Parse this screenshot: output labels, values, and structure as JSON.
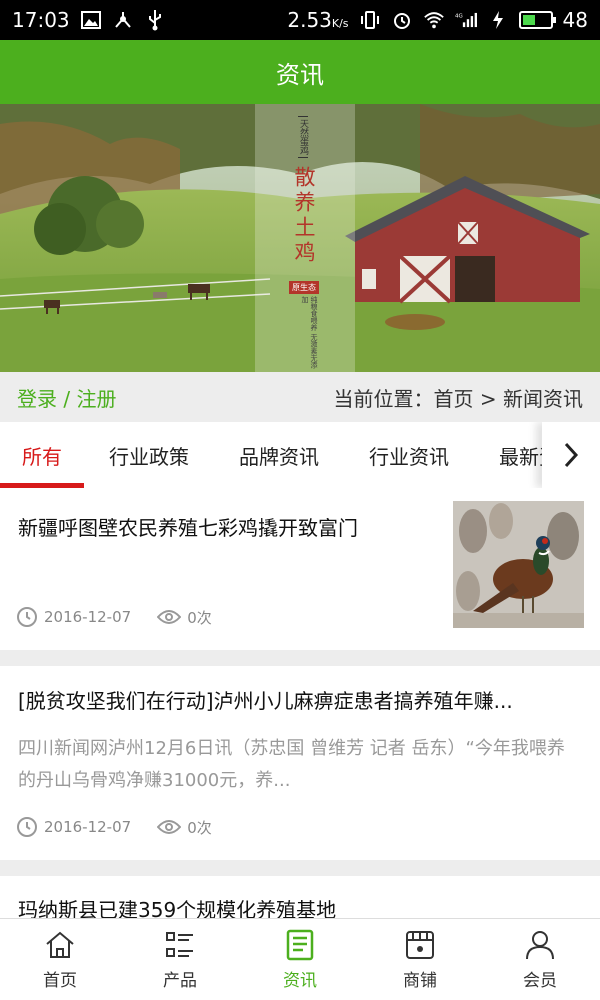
{
  "status_bar": {
    "time": "17:03",
    "speed": "2.53",
    "speed_unit": "K/s",
    "network": "4G",
    "battery": "48",
    "battery_fraction": 0.48,
    "icons": [
      "image-icon",
      "usb-hub-icon",
      "usb-icon",
      "vibrate-icon",
      "alarm-icon",
      "wifi-icon",
      "signal-icon",
      "charging-icon",
      "battery-icon"
    ]
  },
  "header": {
    "title": "资讯"
  },
  "banner": {
    "poster_tag": "天然蛋鸡",
    "poster_title": "散养土鸡",
    "poster_badge": "原生态",
    "poster_small": "纯粮食喂养 无激素无添加"
  },
  "location_bar": {
    "login_label": "登录 / 注册",
    "location_text": "当前位置：首页 > 新闻资讯"
  },
  "tabs": {
    "items": [
      "所有",
      "行业政策",
      "品牌资讯",
      "行业资讯",
      "最新资讯"
    ],
    "active_index": 0
  },
  "articles": [
    {
      "title": "新疆呼图壁农民养殖七彩鸡撬开致富门",
      "date": "2016-12-07",
      "views": "0次",
      "has_thumbnail": true
    },
    {
      "title": "[脱贫攻坚我们在行动]泸州小儿麻痹症患者搞养殖年赚...",
      "summary": "四川新闻网泸州12月6日讯（苏忠国 曾维芳 记者 岳东）“今年我喂养的丹山乌骨鸡净赚31000元，养...",
      "date": "2016-12-07",
      "views": "0次"
    },
    {
      "title": "玛纳斯县已建359个规模化养殖基地"
    }
  ],
  "bottom_nav": {
    "items": [
      {
        "label": "首页",
        "icon": "home-icon"
      },
      {
        "label": "产品",
        "icon": "list-icon"
      },
      {
        "label": "资讯",
        "icon": "news-icon"
      },
      {
        "label": "商铺",
        "icon": "shop-icon"
      },
      {
        "label": "会员",
        "icon": "user-icon"
      }
    ],
    "active_index": 2
  },
  "colors": {
    "brand_green": "#4caf1e",
    "tab_active_red": "#d71a1a",
    "background": "#ededed"
  }
}
